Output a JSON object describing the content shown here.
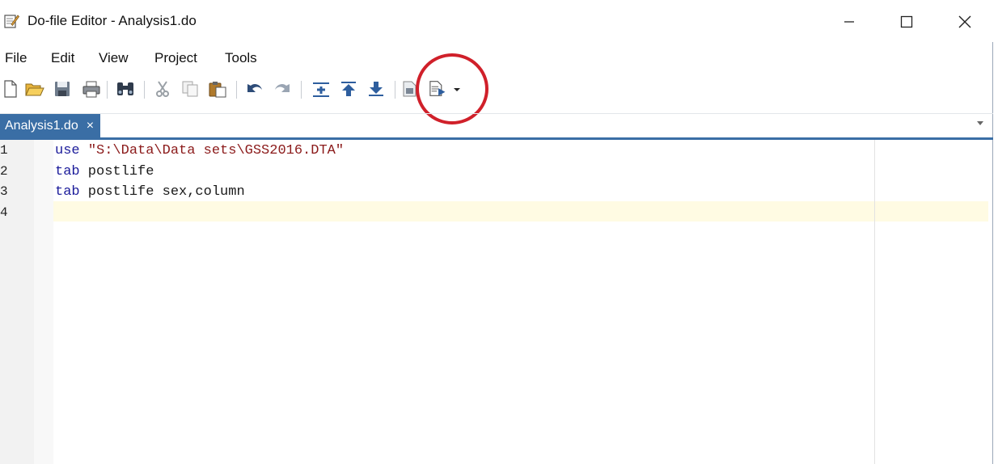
{
  "window": {
    "title": "Do-file Editor - Analysis1.do",
    "minimize_icon": "minimize-icon",
    "maximize_icon": "maximize-icon",
    "close_icon": "close-icon"
  },
  "menu": {
    "items": [
      "File",
      "Edit",
      "View",
      "Project",
      "Tools"
    ]
  },
  "toolbar": {
    "icons": [
      "new-file-icon",
      "open-folder-icon",
      "save-icon",
      "print-icon",
      "find-icon",
      "cut-icon",
      "copy-icon",
      "paste-icon",
      "undo-icon",
      "redo-icon",
      "shift-right-icon",
      "move-up-icon",
      "move-down-icon",
      "execute-quietly-icon",
      "execute-do-icon",
      "chevron-down-icon"
    ],
    "highlight_color": "#d0202a"
  },
  "tabs": {
    "active": {
      "label": "Analysis1.do",
      "close": "×"
    },
    "accent": "#3a6ea5"
  },
  "editor": {
    "line_numbers": [
      "1",
      "2",
      "3",
      "4"
    ],
    "lines": [
      [
        {
          "t": "use",
          "c": "kw"
        },
        {
          "t": " ",
          "c": "id"
        },
        {
          "t": "\"S:\\Data\\Data sets\\GSS2016.DTA\"",
          "c": "str"
        }
      ],
      [
        {
          "t": "tab",
          "c": "kw"
        },
        {
          "t": " postlife",
          "c": "id"
        }
      ],
      [
        {
          "t": "tab",
          "c": "kw"
        },
        {
          "t": " postlife sex,column",
          "c": "id"
        }
      ],
      []
    ]
  }
}
